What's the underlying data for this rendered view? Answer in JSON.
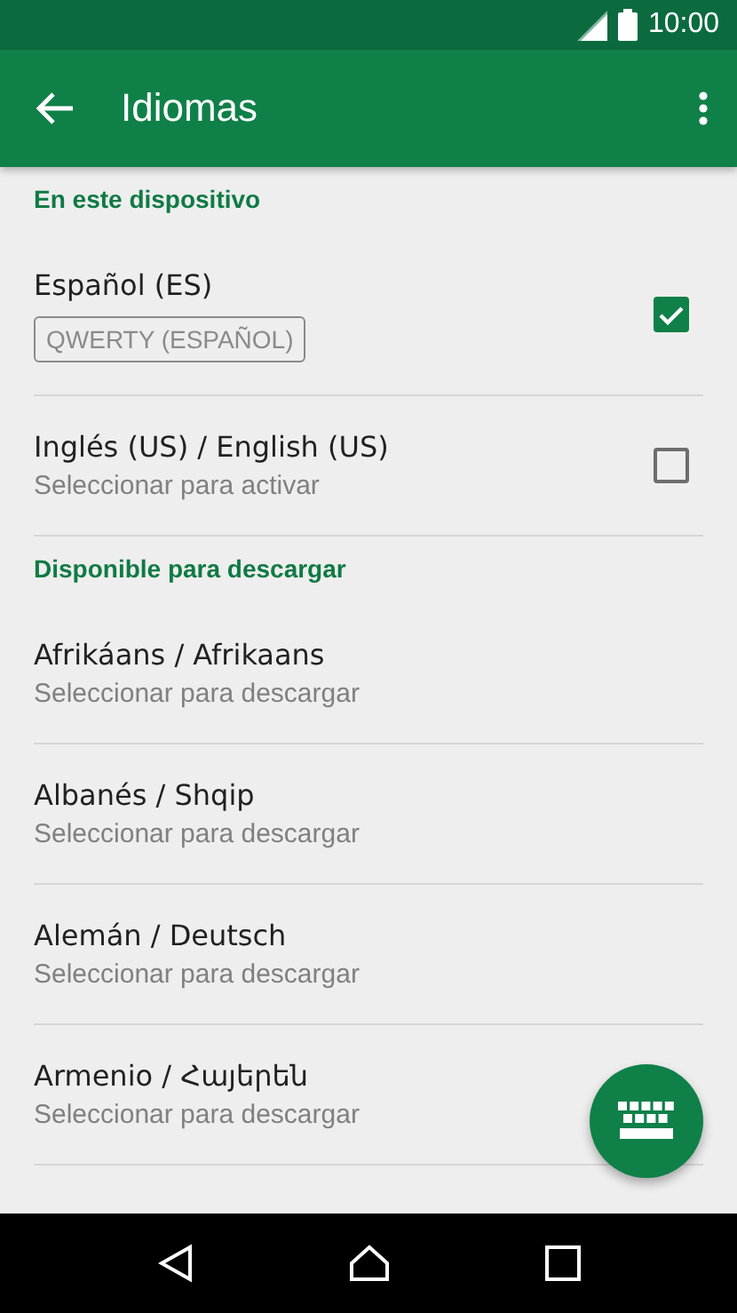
{
  "status_bar": {
    "time": "10:00"
  },
  "app_bar": {
    "title": "Idiomas"
  },
  "sections": [
    {
      "header": "En este dispositivo",
      "items": [
        {
          "kind": "installed",
          "title": "Español (ES)",
          "tag": "QWERTY (ESPAÑOL)",
          "checked": true
        },
        {
          "kind": "installed",
          "title": "Inglés (US) / English (US)",
          "subtitle": "Seleccionar para activar",
          "checked": false
        }
      ]
    },
    {
      "header": "Disponible para descargar",
      "items": [
        {
          "kind": "download",
          "title": "Afrikáans / Afrikaans",
          "subtitle": "Seleccionar para descargar"
        },
        {
          "kind": "download",
          "title": "Albanés / Shqip",
          "subtitle": "Seleccionar para descargar"
        },
        {
          "kind": "download",
          "title": "Alemán / Deutsch",
          "subtitle": "Seleccionar para descargar"
        },
        {
          "kind": "download",
          "title": "Armenio / Հայերեն",
          "subtitle": "Seleccionar para descargar"
        }
      ]
    }
  ]
}
